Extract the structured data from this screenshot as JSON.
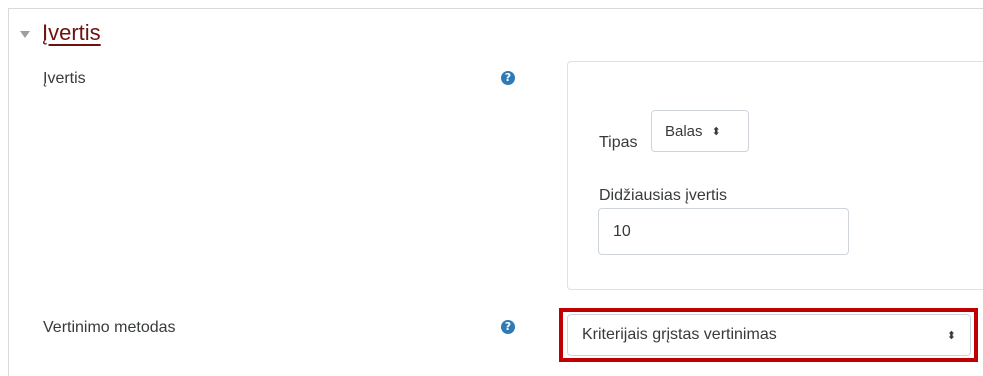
{
  "section": {
    "title": "Įvertis"
  },
  "grade_field": {
    "label": "Įvertis",
    "help_icon": "question-circle-icon"
  },
  "grade_type": {
    "label": "Tipas",
    "selected": "Balas"
  },
  "max_grade": {
    "label": "Didžiausias įvertis",
    "value": "10"
  },
  "grading_method": {
    "label": "Vertinimo metodas",
    "selected": "Kriterijais grįstas vertinimas",
    "help_icon": "question-circle-icon"
  },
  "colors": {
    "accent": "#6d1111",
    "help": "#2f7ab5",
    "highlight": "#c00000"
  }
}
